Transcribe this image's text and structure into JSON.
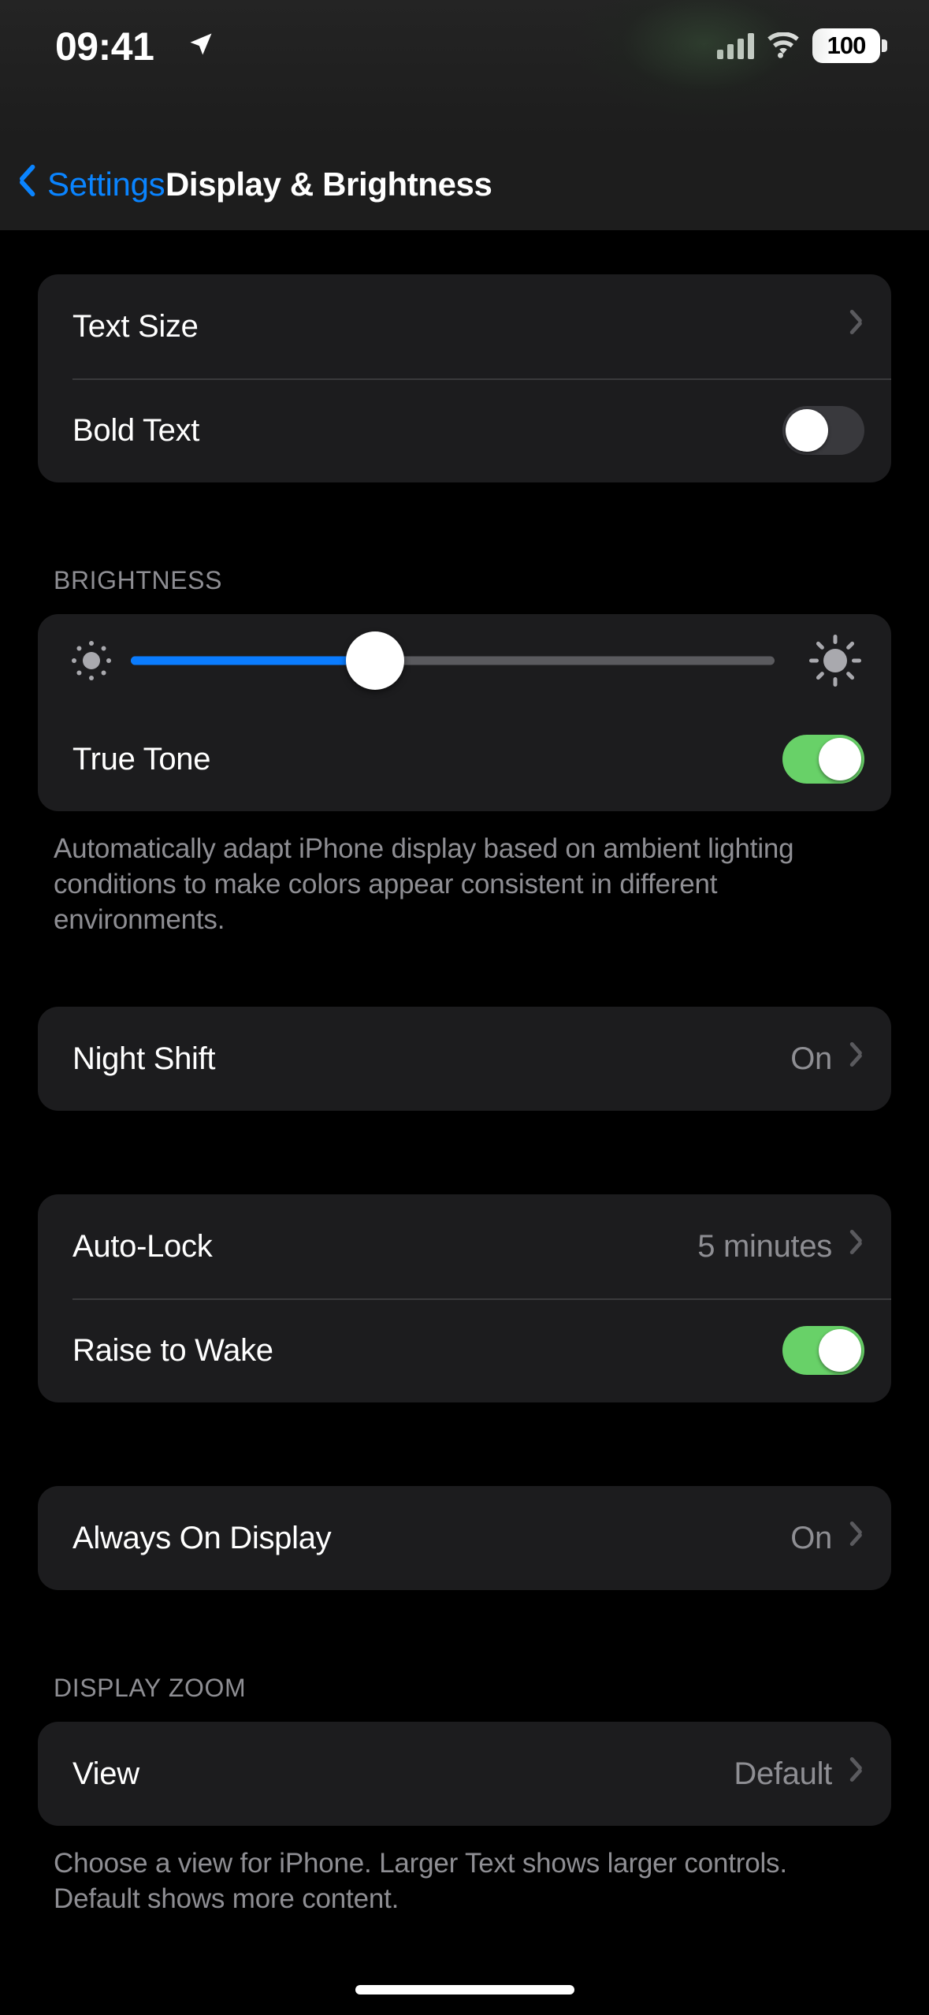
{
  "status_bar": {
    "time": "09:41",
    "location_icon": "location-arrow-icon",
    "cellular_icon": "cellular-bars-icon",
    "wifi_icon": "wifi-icon",
    "battery_percent": "100"
  },
  "nav": {
    "back_label": "Settings",
    "back_icon": "chevron-left-icon",
    "title": "Display & Brightness"
  },
  "sections": {
    "text": {
      "rows": [
        {
          "label": "Text Size",
          "value": "",
          "accessory": "chevron"
        },
        {
          "label": "Bold Text",
          "value": "",
          "accessory": "toggle",
          "toggle_on": false
        }
      ]
    },
    "brightness": {
      "header": "BRIGHTNESS",
      "slider": {
        "name": "brightness-slider",
        "value_percent": 38,
        "min_icon": "sun-small-icon",
        "max_icon": "sun-large-icon"
      },
      "true_tone": {
        "label": "True Tone",
        "toggle_on": true
      },
      "footer": "Automatically adapt iPhone display based on ambient lighting conditions to make colors appear consistent in different environments."
    },
    "night_shift": {
      "rows": [
        {
          "label": "Night Shift",
          "value": "On",
          "accessory": "chevron"
        }
      ]
    },
    "lock": {
      "rows": [
        {
          "label": "Auto-Lock",
          "value": "5 minutes",
          "accessory": "chevron"
        },
        {
          "label": "Raise to Wake",
          "value": "",
          "accessory": "toggle",
          "toggle_on": true
        }
      ]
    },
    "always_on": {
      "rows": [
        {
          "label": "Always On Display",
          "value": "On",
          "accessory": "chevron"
        }
      ]
    },
    "display_zoom": {
      "header": "DISPLAY ZOOM",
      "rows": [
        {
          "label": "View",
          "value": "Default",
          "accessory": "chevron"
        }
      ],
      "footer": "Choose a view for iPhone. Larger Text shows larger controls. Default shows more content."
    }
  },
  "colors": {
    "accent_blue": "#0a84ff",
    "slider_blue": "#0a7cff",
    "toggle_on_green": "#68d168",
    "toggle_off_gray": "#39393d",
    "card_bg": "#1c1c1e",
    "secondary_text": "#8e8e93",
    "background": "#000000"
  }
}
